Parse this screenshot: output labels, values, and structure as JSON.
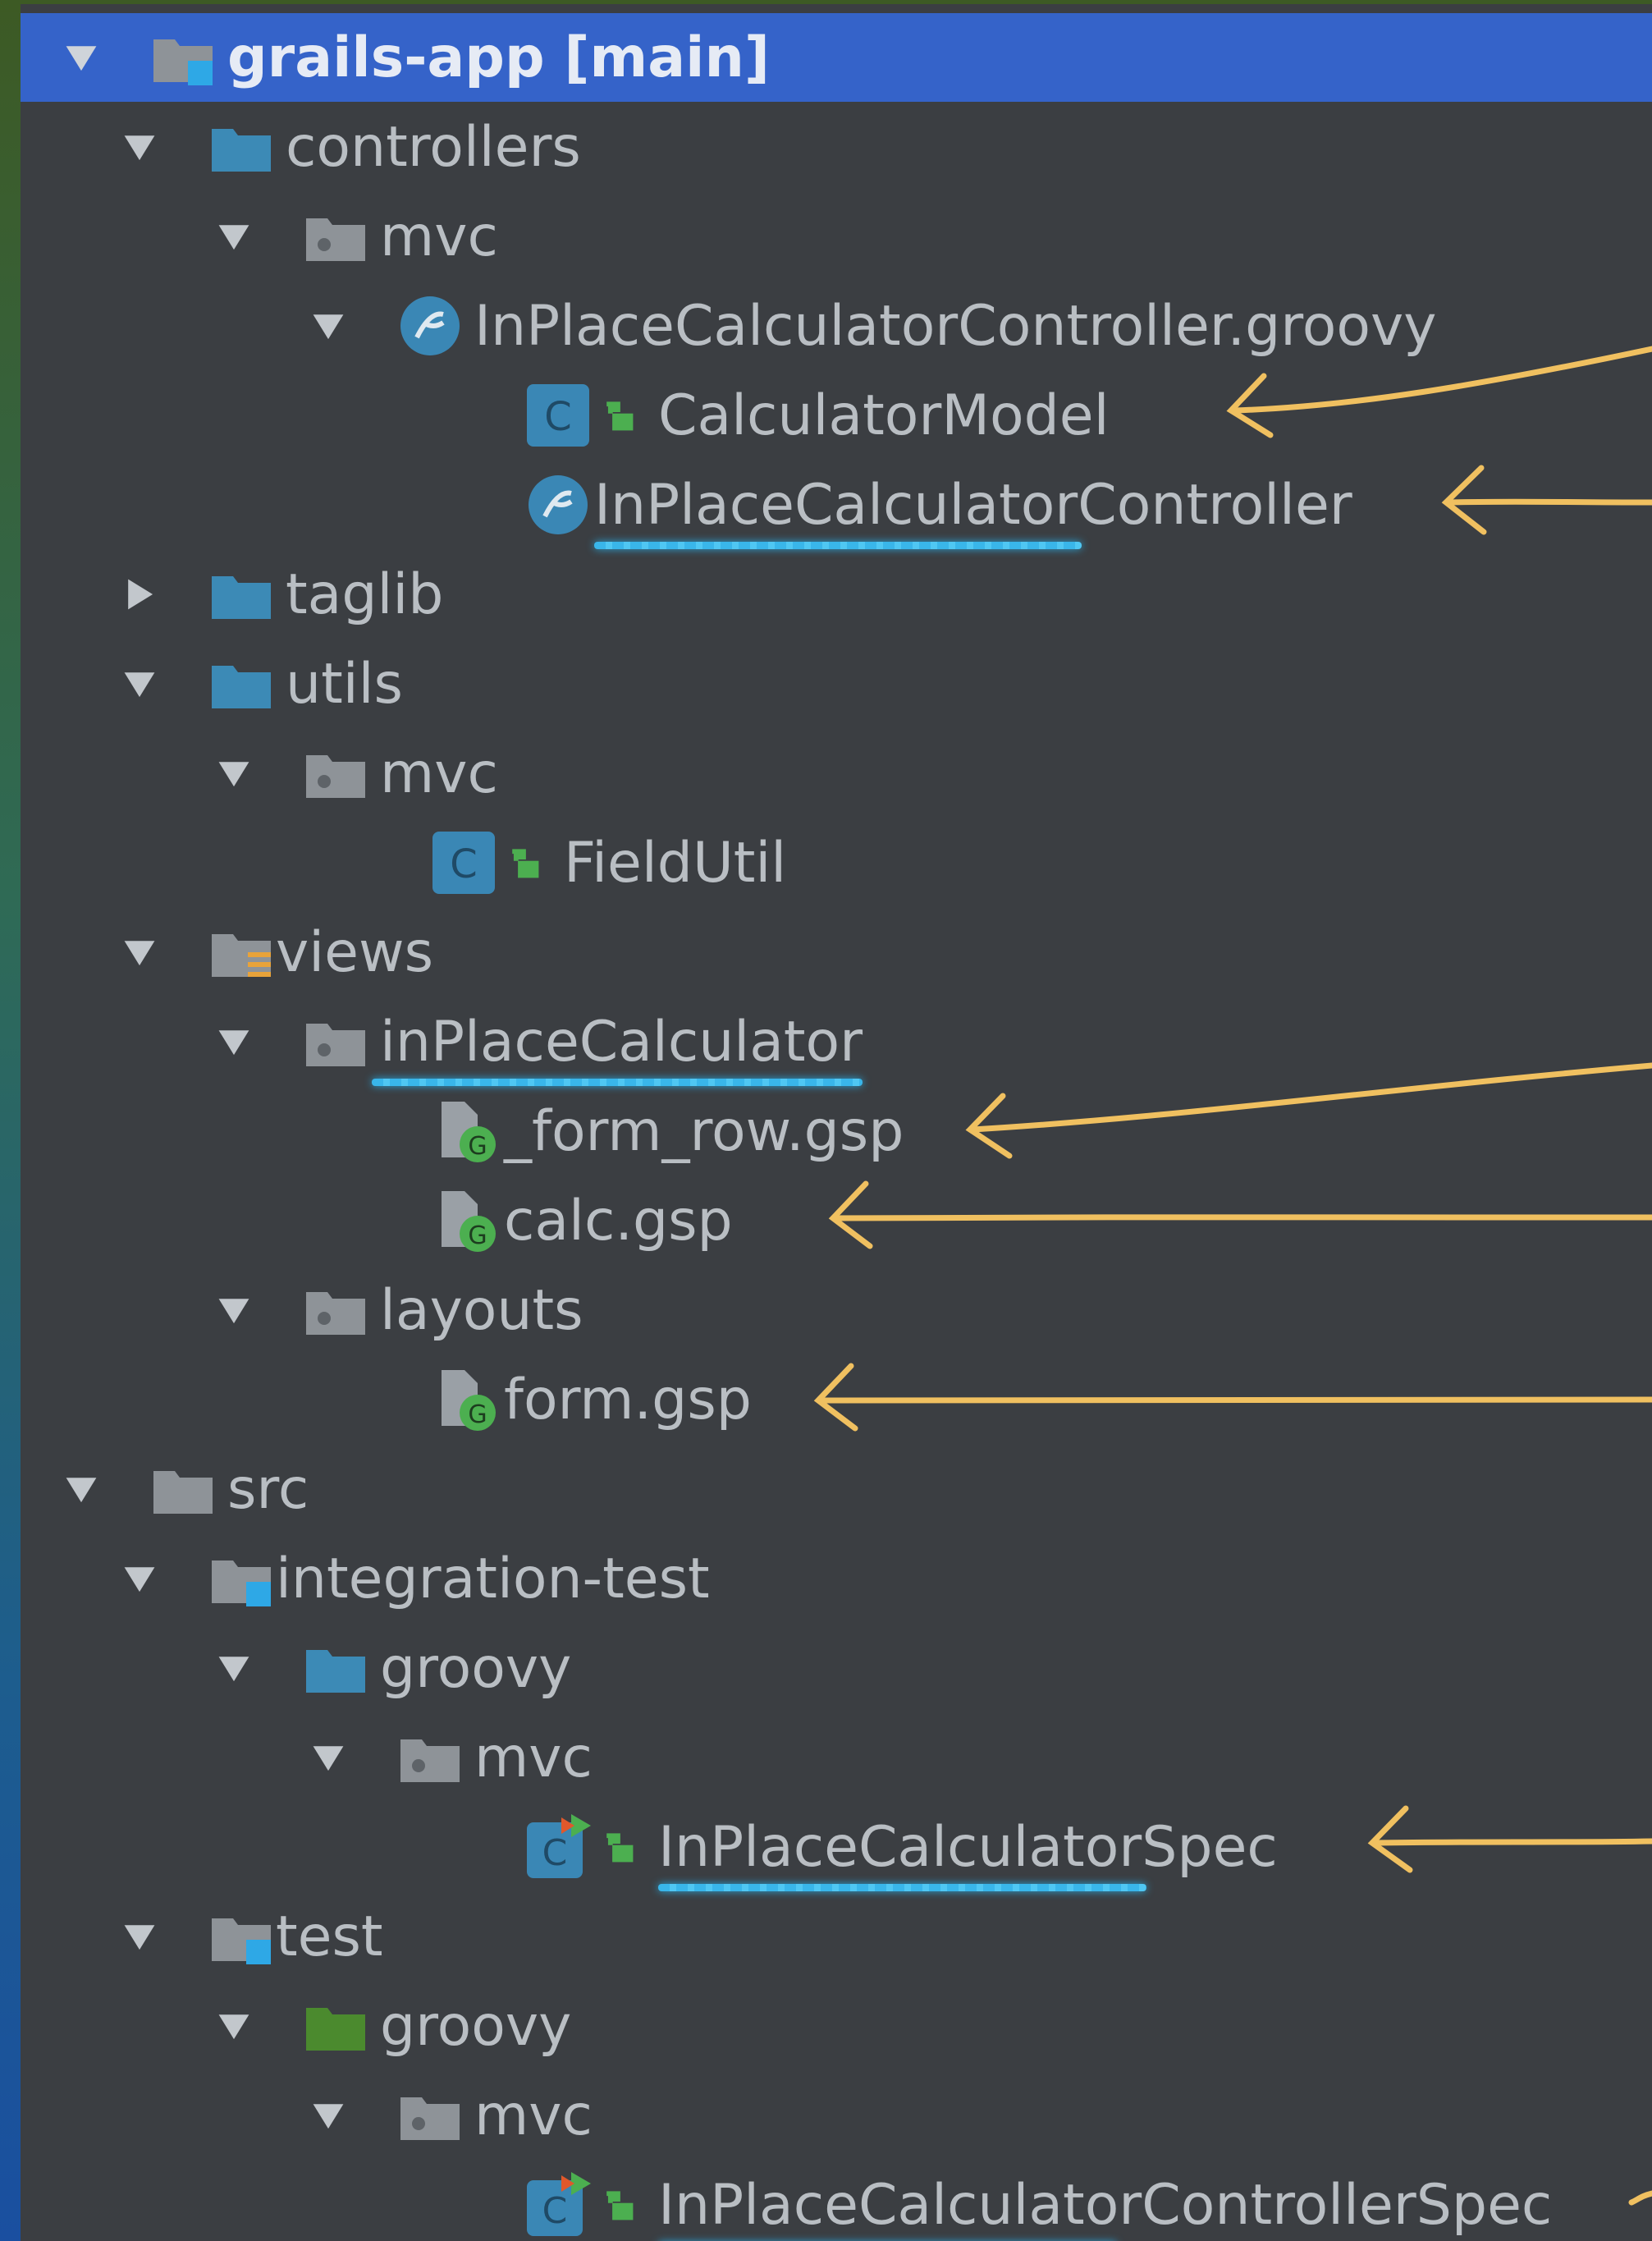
{
  "tree": {
    "rows": [
      {
        "label": "grails-app",
        "suffix": " [main]",
        "icon": "folder-module-blue-icon",
        "expand": "expanded"
      },
      {
        "label": "controllers",
        "icon": "folder-blue-icon",
        "expand": "expanded"
      },
      {
        "label": "mvc",
        "icon": "package-folder-icon",
        "expand": "expanded"
      },
      {
        "label": "InPlaceCalculatorController.groovy",
        "icon": "groovy-file-icon",
        "expand": "expanded"
      },
      {
        "label": "CalculatorModel",
        "icon": "class-icon",
        "lock": "lock-icon"
      },
      {
        "label": "InPlaceCalculatorController",
        "icon": "groovy-controller-icon"
      },
      {
        "label": "taglib",
        "icon": "folder-blue-icon",
        "expand": "collapsed"
      },
      {
        "label": "utils",
        "icon": "folder-blue-icon",
        "expand": "expanded"
      },
      {
        "label": "mvc",
        "icon": "package-folder-icon",
        "expand": "expanded"
      },
      {
        "label": "FieldUtil",
        "icon": "class-icon",
        "lock": "lock-icon"
      },
      {
        "label": "views",
        "icon": "folder-resources-icon",
        "expand": "expanded"
      },
      {
        "label": "inPlaceCalculator",
        "icon": "package-folder-icon",
        "expand": "expanded"
      },
      {
        "label": "_form_row.gsp",
        "icon": "gsp-file-icon"
      },
      {
        "label": "calc.gsp",
        "icon": "gsp-file-icon"
      },
      {
        "label": "layouts",
        "icon": "package-folder-icon",
        "expand": "expanded"
      },
      {
        "label": "form.gsp",
        "icon": "gsp-file-icon"
      },
      {
        "label": "src",
        "icon": "folder-gray-icon",
        "expand": "expanded"
      },
      {
        "label": "integration-test",
        "icon": "folder-module-blue-icon",
        "expand": "expanded"
      },
      {
        "label": "groovy",
        "icon": "folder-blue-icon",
        "expand": "expanded"
      },
      {
        "label": "mvc",
        "icon": "package-folder-icon",
        "expand": "expanded"
      },
      {
        "label": "InPlaceCalculatorSpec",
        "icon": "test-class-icon",
        "lock": "lock-icon"
      },
      {
        "label": "test",
        "icon": "folder-module-blue-icon",
        "expand": "expanded"
      },
      {
        "label": "groovy",
        "icon": "folder-green-icon",
        "expand": "expanded"
      },
      {
        "label": "mvc",
        "icon": "package-folder-icon",
        "expand": "expanded"
      },
      {
        "label": "InPlaceCalculatorControllerSpec",
        "icon": "test-class-icon",
        "lock": "lock-icon"
      }
    ]
  },
  "colors": {
    "selection": "#3563c9",
    "panel": "#3b3e42",
    "text": "#b9bec3",
    "folder_blue": "#3c8ab6",
    "folder_gray": "#8e9398",
    "folder_green": "#4b8a2e",
    "underline": "#39b6ea",
    "annotation_arrow": "#f0c060"
  }
}
